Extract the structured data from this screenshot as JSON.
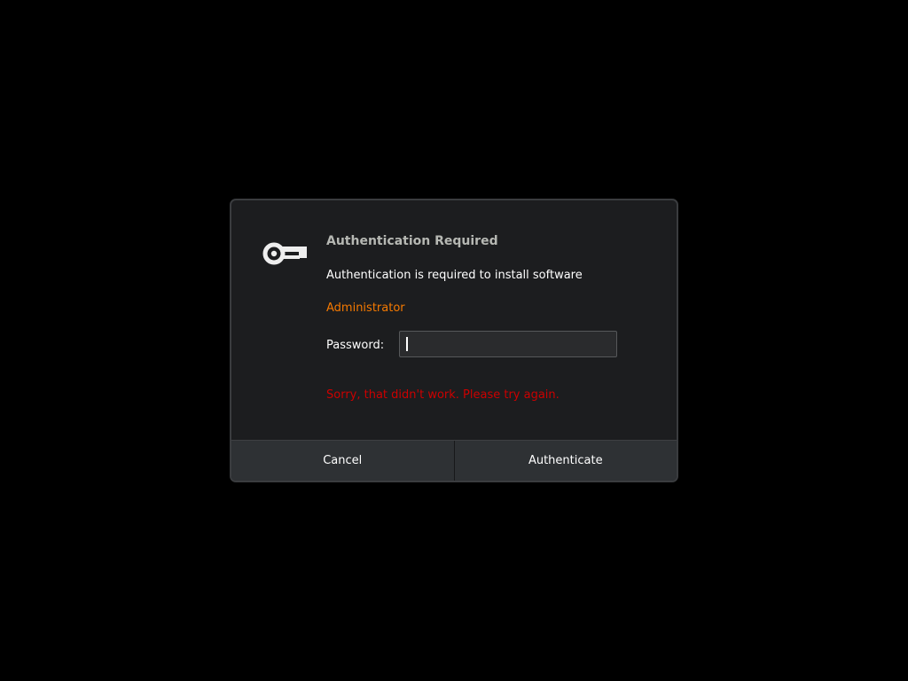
{
  "dialog": {
    "title": "Authentication Required",
    "message": "Authentication is required to install software",
    "user_name": "Administrator",
    "password_label": "Password:",
    "password_value": "",
    "error_message": "Sorry, that didn't work. Please try again.",
    "icon": "key-icon",
    "buttons": {
      "cancel": "Cancel",
      "authenticate": "Authenticate"
    }
  },
  "colors": {
    "background": "#000000",
    "dialog_bg": "#1c1d1f",
    "title": "#b6b8b3",
    "user_accent": "#f57900",
    "error": "#cc0000",
    "button_bg": "#2e3134"
  }
}
